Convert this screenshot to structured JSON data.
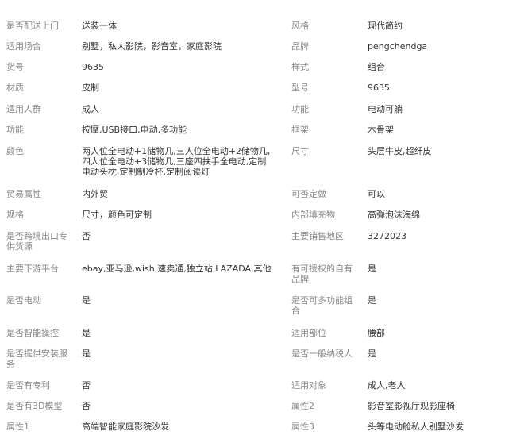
{
  "rows": [
    {
      "k1": "是否配送上门",
      "v1": "送装一体",
      "k2": "风格",
      "v2": "现代简约"
    },
    {
      "k1": "适用场合",
      "v1": "别墅，私人影院，影音室，家庭影院",
      "k2": "品牌",
      "v2": "pengchendga"
    },
    {
      "k1": "货号",
      "v1": "9635",
      "k2": "样式",
      "v2": "组合"
    },
    {
      "k1": "材质",
      "v1": "皮制",
      "k2": "型号",
      "v2": "9635"
    },
    {
      "k1": "适用人群",
      "v1": "成人",
      "k2": "功能",
      "v2": "电动可躺"
    },
    {
      "k1": "功能",
      "v1": "按摩,USB接口,电动,多功能",
      "k2": "框架",
      "v2": "木骨架"
    },
    {
      "k1": "颜色",
      "v1": "两人位全电动+1储物几,三人位全电动+2储物几,四人位全电动+3储物几,三座四扶手全电动,定制电动头枕,定制制冷杯,定制阅读灯",
      "k2": "尺寸",
      "v2": "头层牛皮,超纤皮"
    },
    {
      "k1": "贸易属性",
      "v1": "内外贸",
      "k2": "可否定做",
      "v2": "可以"
    },
    {
      "k1": "规格",
      "v1": "尺寸，颜色可定制",
      "k2": "内部填充物",
      "v2": "高弹泡沫海绵"
    },
    {
      "k1": "是否跨境出口专供货源",
      "v1": "否",
      "k2": "主要销售地区",
      "v2": "3272023"
    },
    {
      "k1": "主要下游平台",
      "v1": "ebay,亚马逊,wish,速卖通,独立站,LAZADA,其他",
      "k2": "有可授权的自有品牌",
      "v2": "是"
    },
    {
      "k1": "是否电动",
      "v1": "是",
      "k2": "是否可多功能组合",
      "v2": "是"
    },
    {
      "k1": "是否智能操控",
      "v1": "是",
      "k2": "适用部位",
      "v2": "腰部"
    },
    {
      "k1": "是否提供安装服务",
      "v1": "是",
      "k2": "是否一般纳税人",
      "v2": "是"
    },
    {
      "k1": "是否有专利",
      "v1": "否",
      "k2": "适用对象",
      "v2": "成人,老人"
    },
    {
      "k1": "是否有3D模型",
      "v1": "否",
      "k2": "属性2",
      "v2": "影音室影视厅观影座椅"
    },
    {
      "k1": "属性1",
      "v1": "高端智能家庭影院沙发",
      "k2": "属性3",
      "v2": "头等电动舱私人别墅沙发"
    }
  ]
}
